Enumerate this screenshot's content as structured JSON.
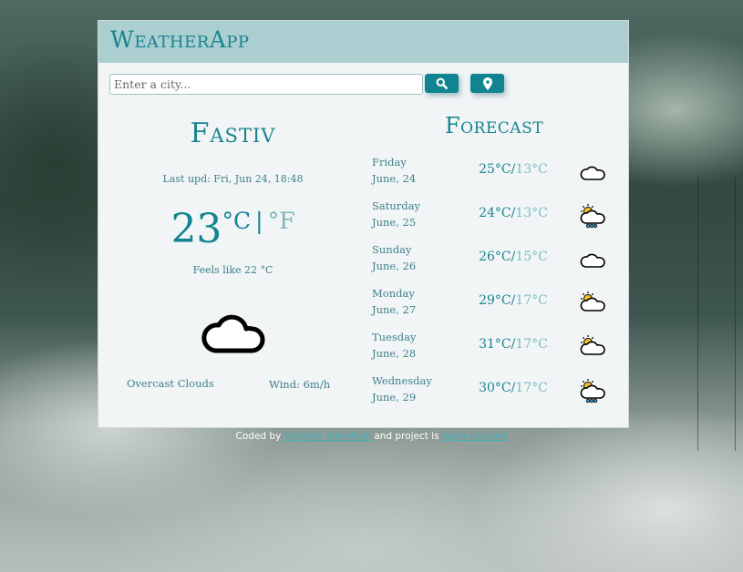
{
  "app": {
    "title": "WeatherApp"
  },
  "search": {
    "placeholder": "Enter a city...",
    "value": "",
    "search_icon": "search-icon",
    "location_icon": "location-pin-icon"
  },
  "current": {
    "city": "Fastiv",
    "last_updated": "Last upd: Fri, Jun 24, 18:48",
    "temperature": "23",
    "unit_c": "°C",
    "unit_separator": "|",
    "unit_f": "°F",
    "feels_like": "Feels like 22 °C",
    "icon": "cloud-icon",
    "description": "Overcast Clouds",
    "wind": "Wind: 6m/h"
  },
  "forecast": {
    "title": "Forecast",
    "days": [
      {
        "day": "Friday",
        "date": "June, 24",
        "max": "25°C",
        "min": "13°C",
        "icon": "cloud"
      },
      {
        "day": "Saturday",
        "date": "June, 25",
        "max": "24°C",
        "min": "13°C",
        "icon": "sun-cloud-rain"
      },
      {
        "day": "Sunday",
        "date": "June, 26",
        "max": "26°C",
        "min": "15°C",
        "icon": "cloud"
      },
      {
        "day": "Monday",
        "date": "June, 27",
        "max": "29°C",
        "min": "17°C",
        "icon": "sun-cloud"
      },
      {
        "day": "Tuesday",
        "date": "June, 28",
        "max": "31°C",
        "min": "17°C",
        "icon": "sun-cloud"
      },
      {
        "day": "Wednesday",
        "date": "June, 29",
        "max": "30°C",
        "min": "17°C",
        "icon": "sun-cloud-rain"
      }
    ],
    "separator": "/"
  },
  "footer": {
    "prefix": "Coded by",
    "author_link": "Svitlana Volkotrub",
    "middle": "and project is",
    "source_link": "open-sourced"
  },
  "colors": {
    "accent": "#118491",
    "header_bg": "#abcfd1",
    "card_bg": "#f1f5f6",
    "text_muted": "#3f7f8a",
    "min_temp": "#7bbcc3"
  }
}
